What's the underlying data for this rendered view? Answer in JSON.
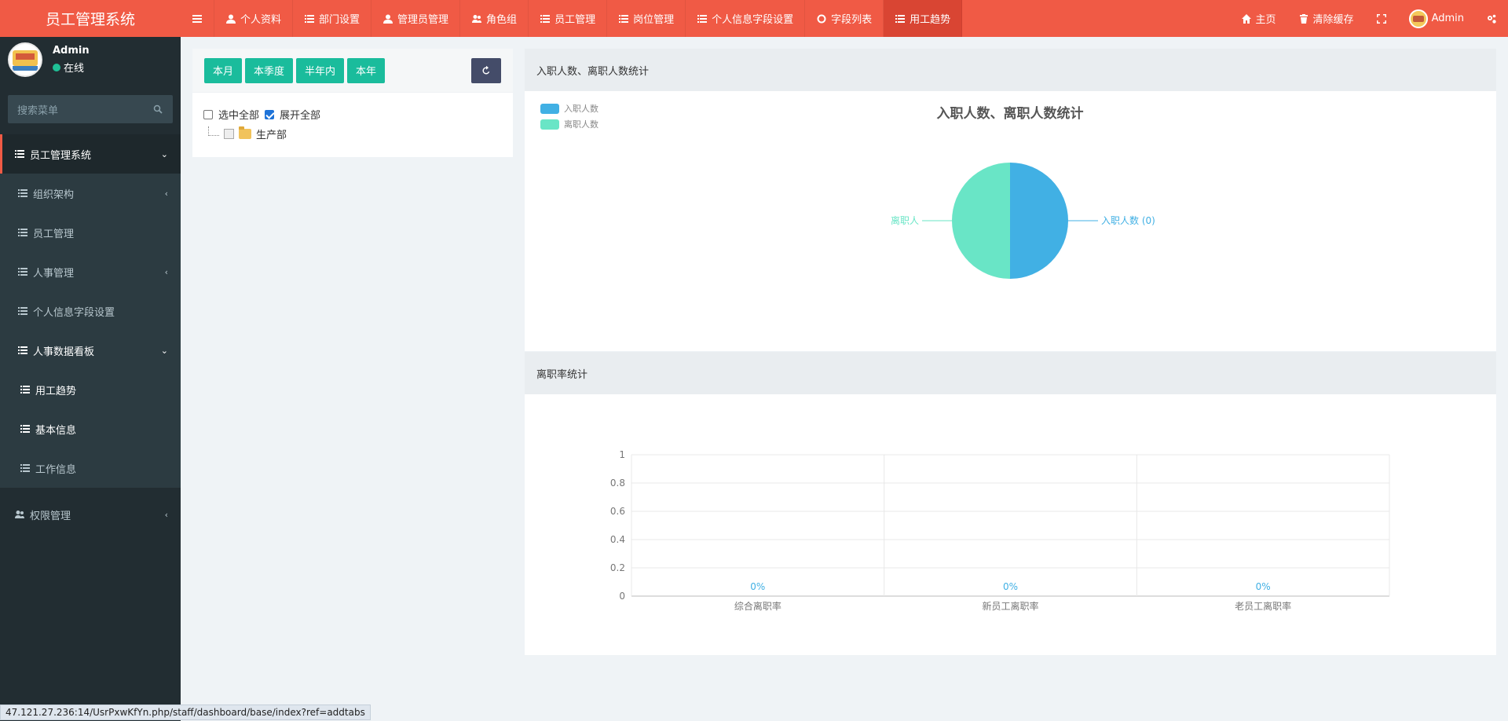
{
  "app": {
    "title": "员工管理系统"
  },
  "topnav": {
    "items": [
      {
        "label": "个人资料",
        "icon": "user-icon"
      },
      {
        "label": "部门设置",
        "icon": "list-icon"
      },
      {
        "label": "管理员管理",
        "icon": "user-icon"
      },
      {
        "label": "角色组",
        "icon": "users-icon"
      },
      {
        "label": "员工管理",
        "icon": "list-icon"
      },
      {
        "label": "岗位管理",
        "icon": "list-icon"
      },
      {
        "label": "个人信息字段设置",
        "icon": "list-icon"
      },
      {
        "label": "字段列表",
        "icon": "circle-icon"
      },
      {
        "label": "用工趋势",
        "icon": "list-icon",
        "active": true
      }
    ],
    "right": {
      "home": "主页",
      "clear_cache": "清除缓存",
      "user": "Admin"
    }
  },
  "sidebar": {
    "user": {
      "name": "Admin",
      "status": "在线"
    },
    "search_placeholder": "搜索菜单",
    "items": [
      {
        "label": "员工管理系统"
      },
      {
        "label": "组织架构"
      },
      {
        "label": "员工管理"
      },
      {
        "label": "人事管理"
      },
      {
        "label": "个人信息字段设置"
      },
      {
        "label": "人事数据看板"
      },
      {
        "label": "用工趋势"
      },
      {
        "label": "基本信息"
      },
      {
        "label": "工作信息"
      },
      {
        "label": "权限管理"
      }
    ]
  },
  "filter": {
    "buttons": [
      "本月",
      "本季度",
      "半年内",
      "本年"
    ],
    "select_all": "选中全部",
    "expand_all": "展开全部",
    "tree": [
      {
        "label": "生产部"
      }
    ]
  },
  "pie_card": {
    "header": "入职人数、离职人数统计"
  },
  "bar_card": {
    "header": "离职率统计"
  },
  "status_url": "47.121.27.236:14/UsrPxwKfYn.php/staff/dashboard/base/index?ref=addtabs",
  "chart_data": [
    {
      "type": "pie",
      "title": "入职人数、离职人数统计",
      "legend_position": "top-left",
      "series": [
        {
          "name": "入职人数",
          "value": 0,
          "color": "#41b0e4",
          "label": "入职人数 (0)"
        },
        {
          "name": "离职人数",
          "value": 0,
          "color": "#69e5c6",
          "label": "离职人"
        }
      ]
    },
    {
      "type": "bar",
      "title": "",
      "categories": [
        "综合离职率",
        "新员工离职率",
        "老员工离职率"
      ],
      "values": [
        0,
        0,
        0
      ],
      "data_labels": [
        "0%",
        "0%",
        "0%"
      ],
      "ylim": [
        0,
        1
      ],
      "yticks": [
        "0",
        "0.2",
        "0.4",
        "0.6",
        "0.8",
        "1"
      ],
      "grid": true,
      "label_color": "#41b0e4"
    }
  ]
}
